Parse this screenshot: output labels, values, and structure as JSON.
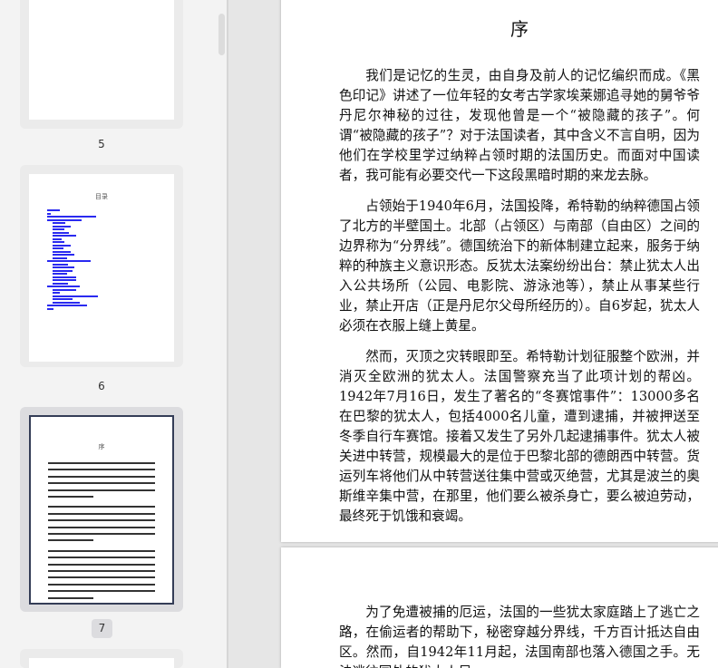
{
  "thumbnails": [
    {
      "label": "5"
    },
    {
      "label": "6",
      "title": "目录"
    },
    {
      "label": "7",
      "title": "序",
      "selected": true
    }
  ],
  "page": {
    "title": "序",
    "paragraphs": [
      "我们是记忆的生灵，由自身及前人的记忆编织而成。《黑色印记》讲述了一位年轻的女考古学家埃莱娜追寻她的舅爷爷丹尼尔神秘的过往，发现他曾是一个“被隐藏的孩子”。何谓“被隐藏的孩子”？对于法国读者，其中含义不言自明，因为他们在学校里学过纳粹占领时期的法国历史。而面对中国读者，我可能有必要交代一下这段黑暗时期的来龙去脉。",
      "占领始于1940年6月，法国投降，希特勒的纳粹德国占领了北方的半壁国土。北部（占领区）与南部（自由区）之间的边界称为“分界线”。德国统治下的新体制建立起来，服务于纳粹的种族主义意识形态。反犹太法案纷纷出台：禁止犹太人出入公共场所（公园、电影院、游泳池等），禁止从事某些行业，禁止开店（正是丹尼尔父母所经历的）。自6岁起，犹太人必须在衣服上缝上黄星。",
      "然而，灭顶之灾转眼即至。希特勒计划征服整个欧洲，并消灭全欧洲的犹太人。法国警察充当了此项计划的帮凶。1942年7月16日，发生了著名的“冬赛馆事件”：13000多名在巴黎的犹太人，包括4000名儿童，遭到逮捕，并被押送至冬季自行车赛馆。接着又发生了另外几起逮捕事件。犹太人被关进中转营，规模最大的是位于巴黎北部的德朗西中转营。货运列车将他们从中转营送往集中营或灭绝营，尤其是波兰的奥斯维辛集中营，在那里，他们要么被杀身亡，要么被迫劳动，最终死于饥饿和衰竭。"
    ]
  },
  "next_page": {
    "paragraphs": [
      "为了免遭被捕的厄运，法国的一些犹太家庭踏上了逃亡之路，在偷运者的帮助下，秘密穿越分界线，千方百计抵达自由区。然而，自1942年11月起，法国南部也落入德国之手。无法逃往国外的犹太人尽"
    ]
  }
}
